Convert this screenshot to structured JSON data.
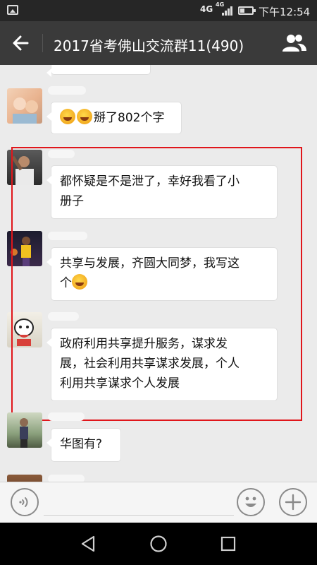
{
  "status_bar": {
    "network_main": "4G",
    "network_small": "4G",
    "time": "下午12:54"
  },
  "header": {
    "title": "2017省考佛山交流群11(490)",
    "back_icon": "back-arrow-icon",
    "members_icon": "people-icon"
  },
  "messages": [
    {
      "text": "掰了802个字",
      "emoji_prefix": 2
    },
    {
      "text_line1": "都怀疑是不是泄了，幸好我看了小",
      "text_line2": "册子"
    },
    {
      "text_line1": "共享与发展，齐圆大同梦，我写这",
      "text_line2": "个",
      "emoji_suffix": 1
    },
    {
      "text_line1": "政府利用共享提升服务，谋求发",
      "text_line2": "展，社会利用共享谋求发展，个人",
      "text_line3": "利用共享谋求个人发展"
    },
    {
      "text": "华图有?"
    }
  ],
  "input_bar": {
    "voice_icon": "voice-icon",
    "emoji_icon": "smiley-icon",
    "plus_icon": "plus-icon"
  },
  "colors": {
    "header_bg": "#3a3a3a",
    "highlight_border": "#e0161b",
    "chat_bg": "#ebebeb"
  }
}
